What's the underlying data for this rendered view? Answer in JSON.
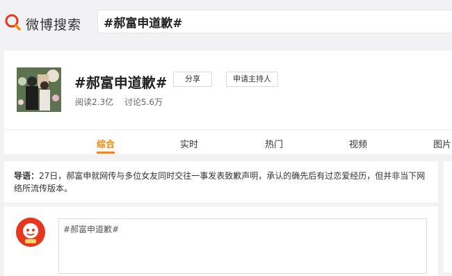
{
  "header": {
    "logo_text": "微博搜索",
    "search_value": "#郝富申道歉#"
  },
  "topic": {
    "title": "#郝富申道歉#",
    "share_label": "分享",
    "host_label": "申请主持人",
    "reads": "阅读2.3亿",
    "discussions": "讨论5.6万"
  },
  "tabs": [
    {
      "label": "综合",
      "active": true
    },
    {
      "label": "实时"
    },
    {
      "label": "热门"
    },
    {
      "label": "视频"
    },
    {
      "label": "图片"
    }
  ],
  "intro": {
    "prefix": "导语：",
    "text": "27日，郝富申就网传与多位女友同时交往一事发表致歉声明，承认的确先后有过恋爱经历，但并非当下网络所流传版本。"
  },
  "composer": {
    "input_value": "#郝富申道歉#"
  },
  "colors": {
    "accent": "#ff8200",
    "logo_red": "#e8361c"
  },
  "icons": {
    "logo": "weibo-search-logo-icon",
    "post_avatar": "user-avatar"
  }
}
